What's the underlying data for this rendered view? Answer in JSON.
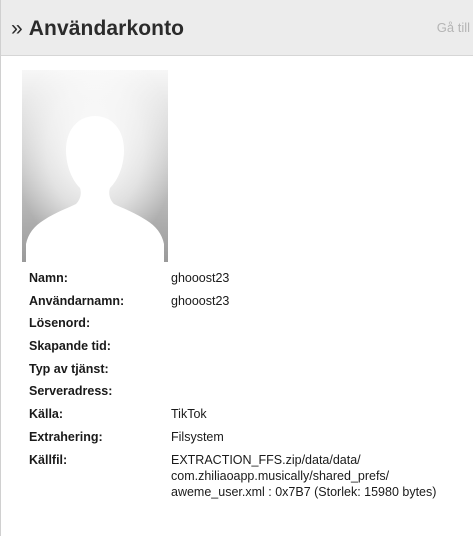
{
  "header": {
    "chevron": "»",
    "title": "Användarkonto",
    "goto_label": "Gå till"
  },
  "avatar": {
    "icon": "default-user-avatar-icon"
  },
  "fields": [
    {
      "label": "Namn:",
      "value": "ghooost23"
    },
    {
      "label": "Användarnamn:",
      "value": "ghooost23"
    },
    {
      "label": "Lösenord:",
      "value": ""
    },
    {
      "label": "Skapande tid:",
      "value": ""
    },
    {
      "label": "Typ av tjänst:",
      "value": ""
    },
    {
      "label": "Serveradress:",
      "value": ""
    },
    {
      "label": "Källa:",
      "value": "TikTok"
    },
    {
      "label": "Extrahering:",
      "value": "Filsystem"
    }
  ],
  "source_file": {
    "label": "Källfil:",
    "lines": [
      "EXTRACTION_FFS.zip/data/data/",
      "com.zhiliaoapp.musically/shared_prefs/",
      "aweme_user.xml : 0x7B7 (Storlek: 15980 bytes)"
    ]
  },
  "colors": {
    "header_bg": "#ececec",
    "title_text": "#2b2b2b",
    "goto_text": "#b5b5b5"
  }
}
